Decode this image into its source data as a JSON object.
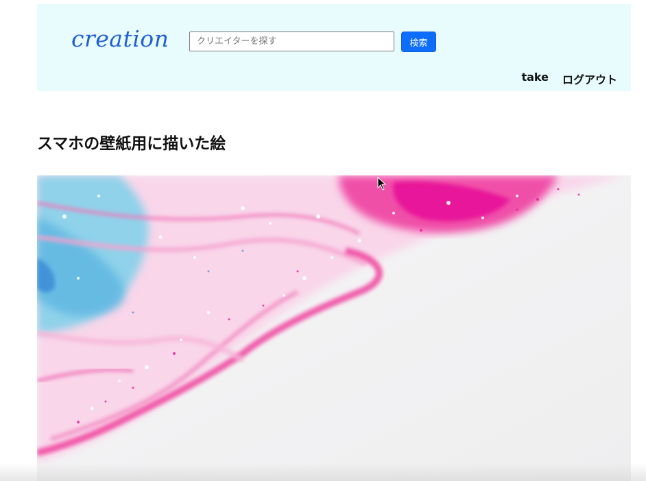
{
  "header": {
    "logo": "creation",
    "search": {
      "placeholder": "クリエイターを探す",
      "button_label": "検索"
    },
    "nav": [
      {
        "label": "take"
      },
      {
        "label": "ログアウト"
      }
    ]
  },
  "post": {
    "title": "スマホの壁紙用に描いた絵",
    "image_colors": {
      "base": "#f3f3f4",
      "pink": "#f0459f",
      "magenta": "#e8189a",
      "cyan": "#6cc6e3",
      "blue": "#3d8fd6"
    }
  }
}
